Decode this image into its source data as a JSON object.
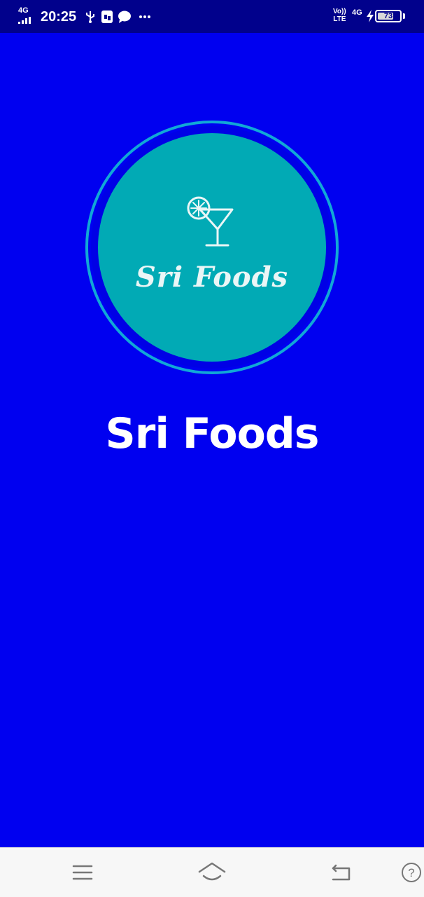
{
  "status_bar": {
    "network_type": "4G",
    "time": "20:25",
    "volte_top": "Vo))",
    "volte_bottom": "LTE",
    "network_type_right": "4G",
    "battery_percent": "73",
    "battery_level": 0.73,
    "icons": [
      "usb-icon",
      "sim-icon",
      "message-icon",
      "more-icon",
      "bolt-icon"
    ]
  },
  "logo": {
    "text": "Sri Foods",
    "icon": "cocktail-glass-icon",
    "colors": {
      "ring": "#11A8D6",
      "disc": "#01AAB5",
      "text": "#EAF6F6"
    }
  },
  "app_title": "Sri Foods",
  "colors": {
    "background": "#0000F0",
    "status_bar": "#01018C",
    "nav_bar": "#F7F7F7"
  },
  "nav_bar": {
    "buttons": [
      "menu-icon",
      "home-icon",
      "back-icon",
      "help-icon"
    ],
    "help_symbol": "?"
  }
}
